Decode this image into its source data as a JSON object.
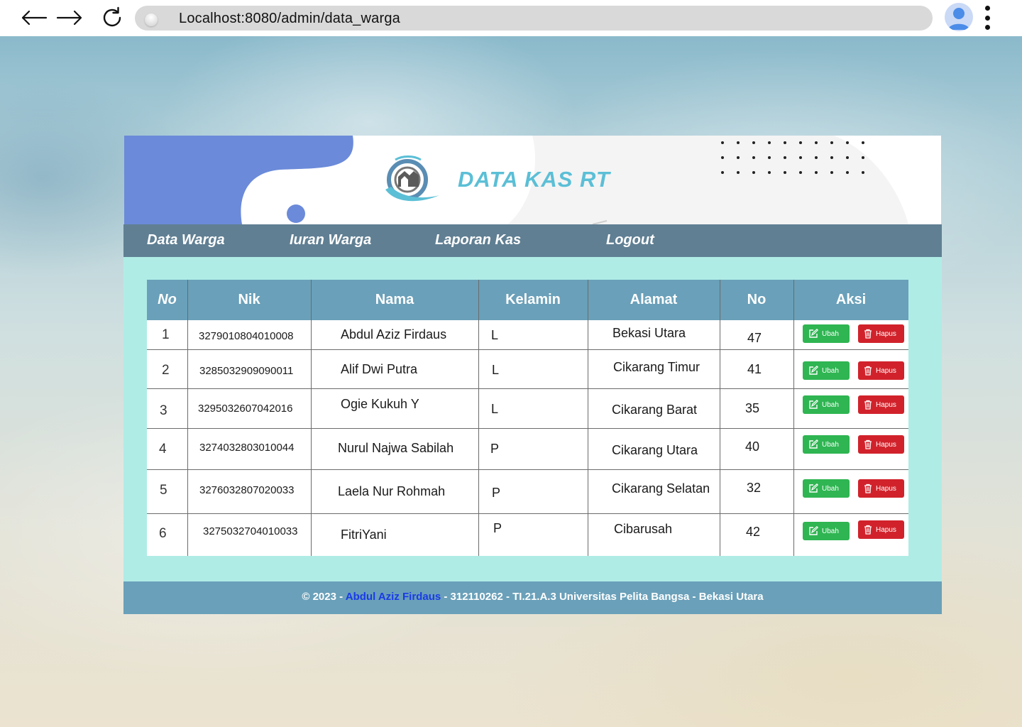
{
  "browser": {
    "url": "Localhost:8080/admin/data_warga"
  },
  "header": {
    "title": "DATA KAS RT"
  },
  "nav": {
    "items": [
      "Data Warga",
      "Iuran Warga",
      "Laporan Kas",
      "Logout"
    ]
  },
  "table": {
    "headers": [
      "No",
      "Nik",
      "Nama",
      "Kelamin",
      "Alamat",
      "No",
      "Aksi"
    ],
    "rows": [
      {
        "no": "1",
        "nik": "3279010804010008",
        "nama": "Abdul Aziz Firdaus",
        "kelamin": "L",
        "alamat": "Bekasi Utara",
        "no_rumah": "47"
      },
      {
        "no": "2",
        "nik": "3285032909090011",
        "nama": "Alif Dwi Putra",
        "kelamin": "L",
        "alamat": "Cikarang Timur",
        "no_rumah": "41"
      },
      {
        "no": "3",
        "nik": "3295032607042016",
        "nama": "Ogie Kukuh Y",
        "kelamin": "L",
        "alamat": "Cikarang Barat",
        "no_rumah": "35"
      },
      {
        "no": "4",
        "nik": "3274032803010044",
        "nama": "Nurul Najwa Sabilah",
        "kelamin": "P",
        "alamat": "Cikarang Utara",
        "no_rumah": "40"
      },
      {
        "no": "5",
        "nik": "3276032807020033",
        "nama": "Laela Nur Rohmah",
        "kelamin": "P",
        "alamat": "Cikarang Selatan",
        "no_rumah": "32"
      },
      {
        "no": "6",
        "nik": "3275032704010033",
        "nama": "FitriYani",
        "kelamin": "P",
        "alamat": "Cibarusah",
        "no_rumah": "42"
      }
    ],
    "edit_label": "Ubah",
    "delete_label": "Hapus"
  },
  "footer": {
    "prefix": "© 2023 - ",
    "author": "Abdul Aziz Firdaus",
    "suffix": " - 312110262 - TI.21.A.3 Universitas Pelita Bangsa - Bekasi Utara"
  },
  "colors": {
    "nav_bg": "#607f93",
    "table_header_bg": "#6aa0b9",
    "content_bg": "#b0ece6",
    "title": "#5bbfd6",
    "edit_button": "#2fb552",
    "delete_button": "#d1222b",
    "footer_author": "#1a3be6"
  },
  "icons": [
    "arrow-left-icon",
    "arrow-right-icon",
    "reload-icon",
    "user-avatar-icon",
    "more-vertical-icon",
    "edit-icon",
    "trash-icon",
    "logo-icon"
  ]
}
